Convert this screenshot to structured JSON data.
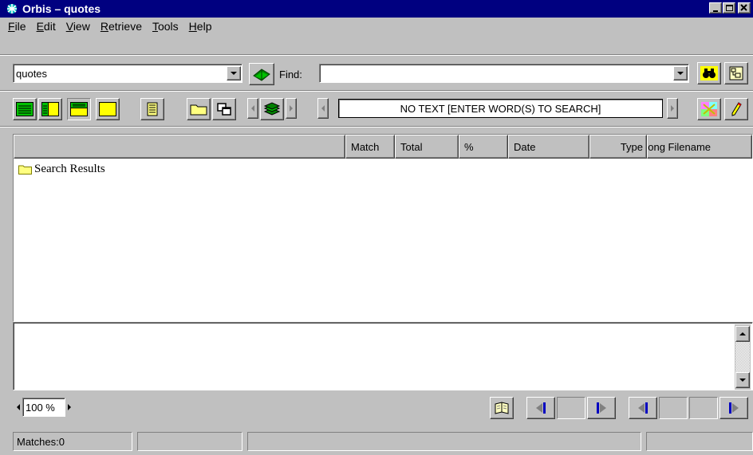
{
  "window": {
    "title": "Orbis – quotes",
    "app_icon": "orbis-logo-icon"
  },
  "title_controls": [
    "minimize-icon",
    "maximize-icon",
    "close-icon"
  ],
  "menu": [
    {
      "label": "File",
      "hotkey": "F"
    },
    {
      "label": "Edit",
      "hotkey": "E"
    },
    {
      "label": "View",
      "hotkey": "V"
    },
    {
      "label": "Retrieve",
      "hotkey": "R"
    },
    {
      "label": "Tools",
      "hotkey": "T"
    },
    {
      "label": "Help",
      "hotkey": "H"
    }
  ],
  "toolbar": {
    "database_value": "quotes",
    "find_label": "Find:",
    "find_value": "",
    "search_status": "NO TEXT [ENTER WORD(S) TO SEARCH]"
  },
  "results": {
    "columns": [
      "",
      "Match",
      "Total",
      "%",
      "Date",
      "Type",
      "Long Filename"
    ],
    "tree_items": [
      "Search Results"
    ]
  },
  "zoom": {
    "value": "100 %"
  },
  "status": {
    "matches": "Matches:0"
  },
  "colors": {
    "titlebar": "#000080",
    "face": "#c0c0c0",
    "folder": "#ffff80",
    "highlight": "#00a000"
  }
}
